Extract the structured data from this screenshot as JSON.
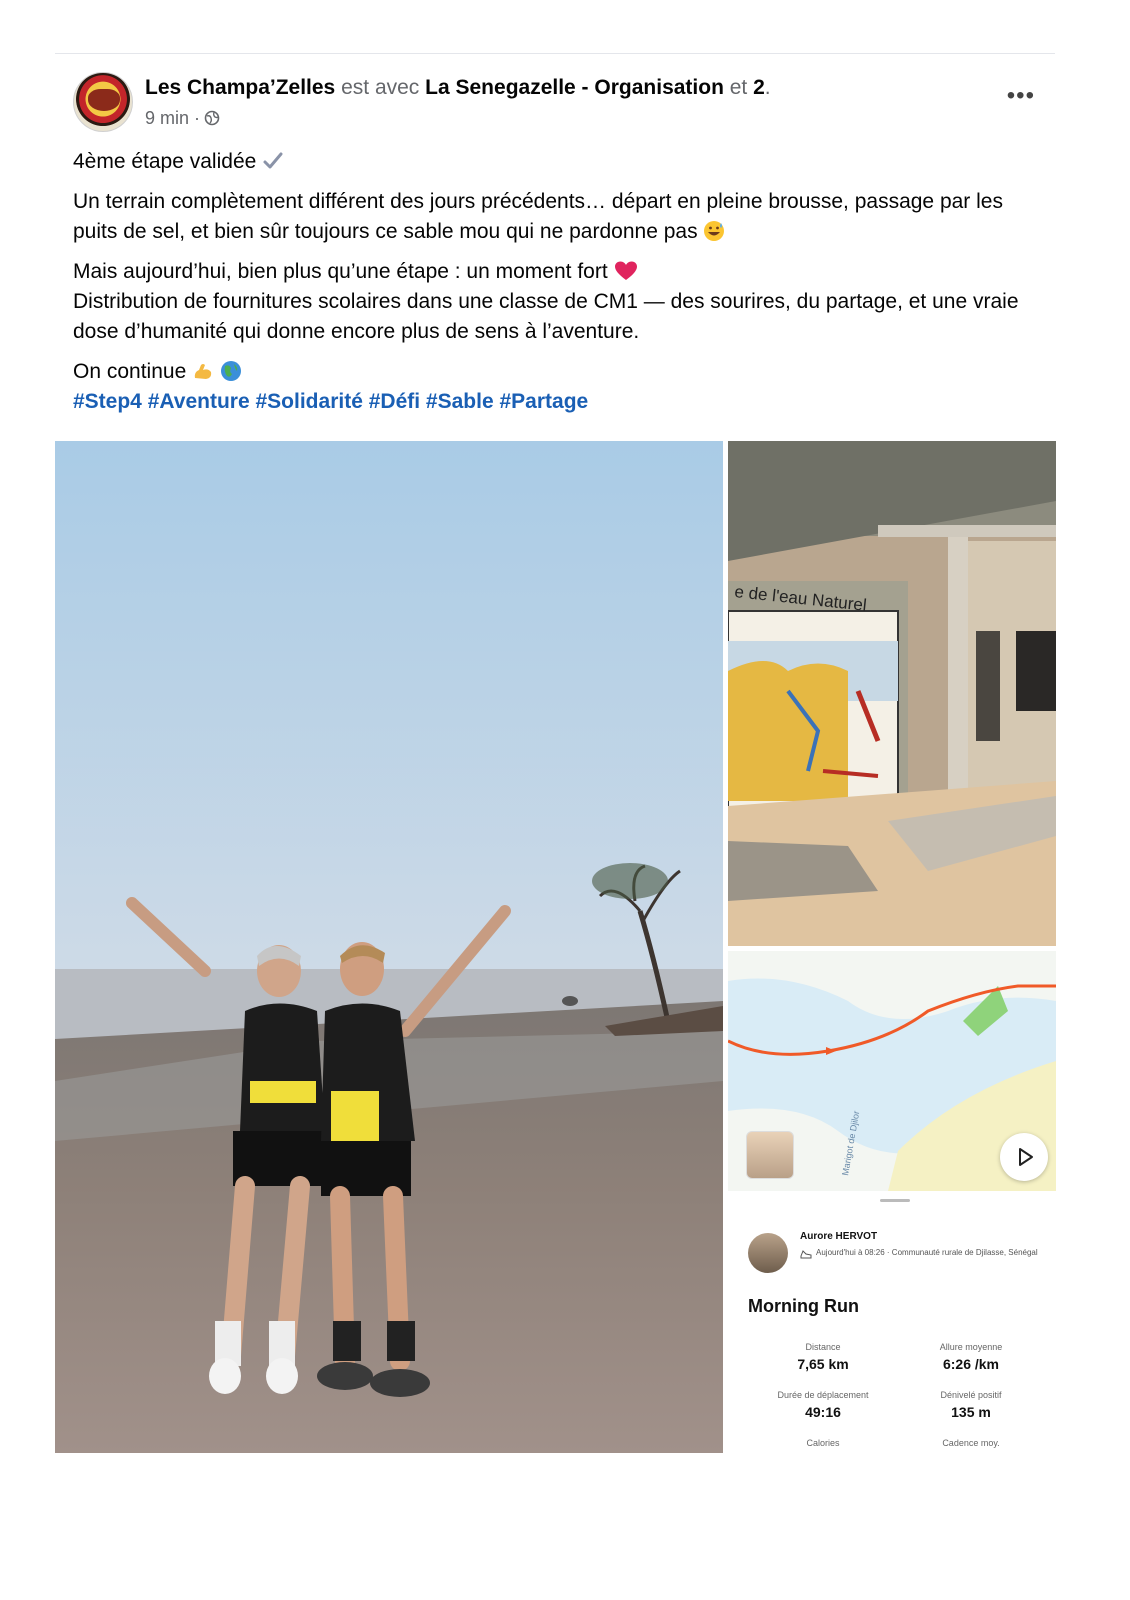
{
  "post": {
    "author": "Les Champa’Zelles",
    "with_word": "est avec",
    "tagged": "La Senegazelle - Organisation",
    "and_word": "et",
    "others_count": "2",
    "time": "9 min ·",
    "more": "•••",
    "line1": "4ème étape validée",
    "para2": "Un terrain complètement différent des jours précédents… départ en pleine brousse, passage par les puits de sel, et bien sûr toujours ce sable mou qui ne pardonne pas",
    "para3a": "Mais aujourd’hui, bien plus qu’une étape : un moment fort",
    "para3b": "Distribution de fournitures scolaires dans une classe de CM1 — des sourires, du partage, et une vraie dose d’humanité qui donne encore plus de sens à l’aventure.",
    "para4": "On continue",
    "hashtags": [
      "#Step4",
      "#Aventure",
      "#Solidarité",
      "#Défi",
      "#Sable",
      "#Partage"
    ]
  },
  "mural_text": "e de l'eau Naturel",
  "strava": {
    "athlete": "Aurore HERVOT",
    "subtitle": "Aujourd'hui à 08:26 · Communauté rurale de Djilasse, Sénégal",
    "title": "Morning Run",
    "stats": [
      {
        "label": "Distance",
        "value": "7,65 km"
      },
      {
        "label": "Allure moyenne",
        "value": "6:26 /km"
      },
      {
        "label": "Durée de déplacement",
        "value": "49:16"
      },
      {
        "label": "Dénivelé positif",
        "value": "135 m"
      },
      {
        "label": "Calories",
        "value": ""
      },
      {
        "label": "Cadence moy.",
        "value": ""
      }
    ],
    "map_label": "Marigot de Djilor"
  },
  "colors": {
    "hashtag": "#1a5fb4",
    "route": "#f05a28",
    "muted": "#65676b"
  }
}
